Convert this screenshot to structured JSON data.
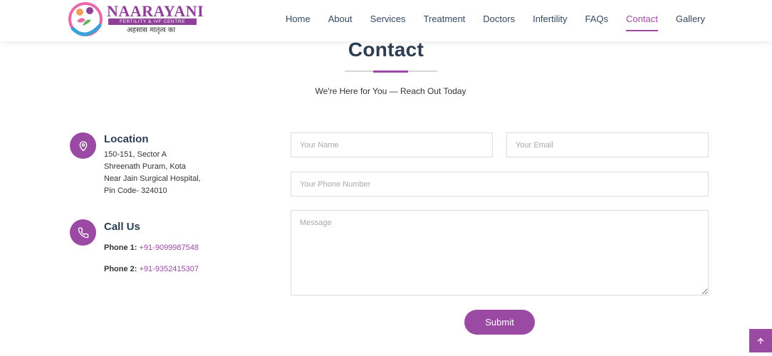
{
  "brand": {
    "name": "NAARAYANI",
    "subtitle": "FERTILITY & IVF CENTRE",
    "tagline": "अहसास मातृत्व का",
    "accent_color": "#9b4aa3"
  },
  "nav": {
    "items": [
      {
        "label": "Home"
      },
      {
        "label": "About"
      },
      {
        "label": "Services"
      },
      {
        "label": "Treatment"
      },
      {
        "label": "Doctors"
      },
      {
        "label": "Infertility"
      },
      {
        "label": "FAQs"
      },
      {
        "label": "Contact",
        "active": true
      },
      {
        "label": "Gallery"
      }
    ]
  },
  "section": {
    "title": "Contact",
    "subtitle": "We're Here for You — Reach Out Today"
  },
  "location": {
    "icon": "map-pin-icon",
    "title": "Location",
    "lines": [
      "150-151, Sector A",
      "Shreenath Puram, Kota",
      "Near Jain Surgical Hospital,",
      "Pin Code- 324010"
    ]
  },
  "call": {
    "icon": "phone-icon",
    "title": "Call Us",
    "phone1_label": "Phone 1:",
    "phone1": "+91-9099987548",
    "phone2_label": "Phone 2:",
    "phone2": "+91-9352415307"
  },
  "form": {
    "name_placeholder": "Your Name",
    "email_placeholder": "Your Email",
    "phone_placeholder": "Your Phone Number",
    "message_placeholder": "Message",
    "submit_label": "Submit"
  },
  "scroll_top": {
    "icon": "arrow-up-icon"
  }
}
